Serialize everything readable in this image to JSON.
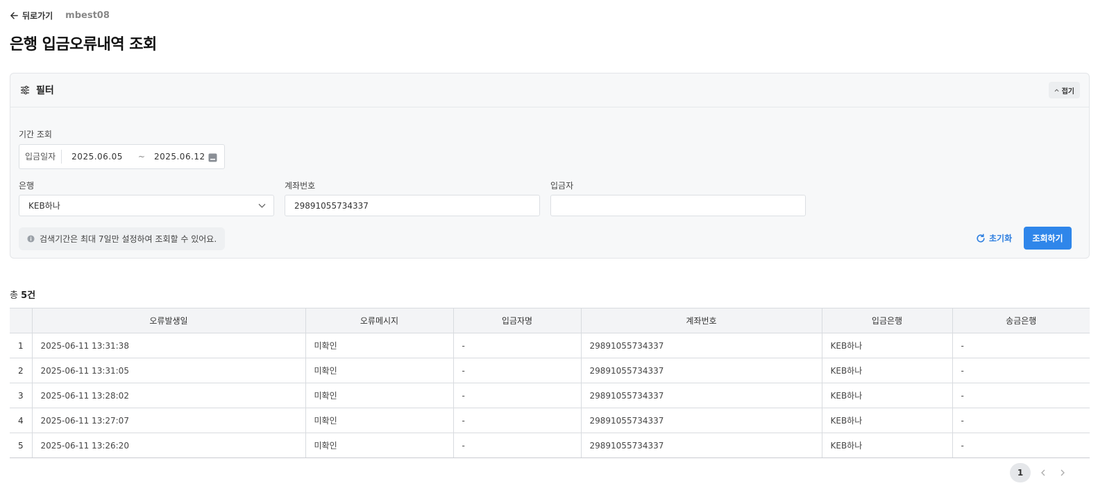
{
  "header": {
    "back_label": "뒤로가기",
    "user_id": "mbest08",
    "page_title": "은행 입금오류내역 조회"
  },
  "filter": {
    "title": "필터",
    "collapse_label": "접기",
    "period_label": "기간 조회",
    "date_type": "입금일자",
    "date_from": "2025.06.05",
    "date_sep": "~",
    "date_to": "2025.06.12",
    "bank_label": "은행",
    "bank_value": "KEB하나",
    "account_label": "계좌번호",
    "account_value": "29891055734337",
    "depositor_label": "입금자",
    "depositor_value": "",
    "info_text": "검색기간은 최대 7일만 설정하여 조회할 수 있어요.",
    "reset_label": "초기화",
    "search_label": "조회하기"
  },
  "results": {
    "total_prefix": "총",
    "total_count": "5건",
    "columns": [
      "",
      "오류발생일",
      "오류메시지",
      "입금자명",
      "계좌번호",
      "입금은행",
      "송금은행"
    ],
    "rows": [
      {
        "no": "1",
        "date": "2025-06-11 13:31:38",
        "message": "미확인",
        "depositor": "-",
        "account": "29891055734337",
        "bank": "KEB하나",
        "sender_bank": "-"
      },
      {
        "no": "2",
        "date": "2025-06-11 13:31:05",
        "message": "미확인",
        "depositor": "-",
        "account": "29891055734337",
        "bank": "KEB하나",
        "sender_bank": "-"
      },
      {
        "no": "3",
        "date": "2025-06-11 13:28:02",
        "message": "미확인",
        "depositor": "-",
        "account": "29891055734337",
        "bank": "KEB하나",
        "sender_bank": "-"
      },
      {
        "no": "4",
        "date": "2025-06-11 13:27:07",
        "message": "미확인",
        "depositor": "-",
        "account": "29891055734337",
        "bank": "KEB하나",
        "sender_bank": "-"
      },
      {
        "no": "5",
        "date": "2025-06-11 13:26:20",
        "message": "미확인",
        "depositor": "-",
        "account": "29891055734337",
        "bank": "KEB하나",
        "sender_bank": "-"
      }
    ]
  },
  "pagination": {
    "current_page": "1"
  },
  "colors": {
    "primary": "#2f86ea",
    "link_blue": "#2f7fe0"
  }
}
